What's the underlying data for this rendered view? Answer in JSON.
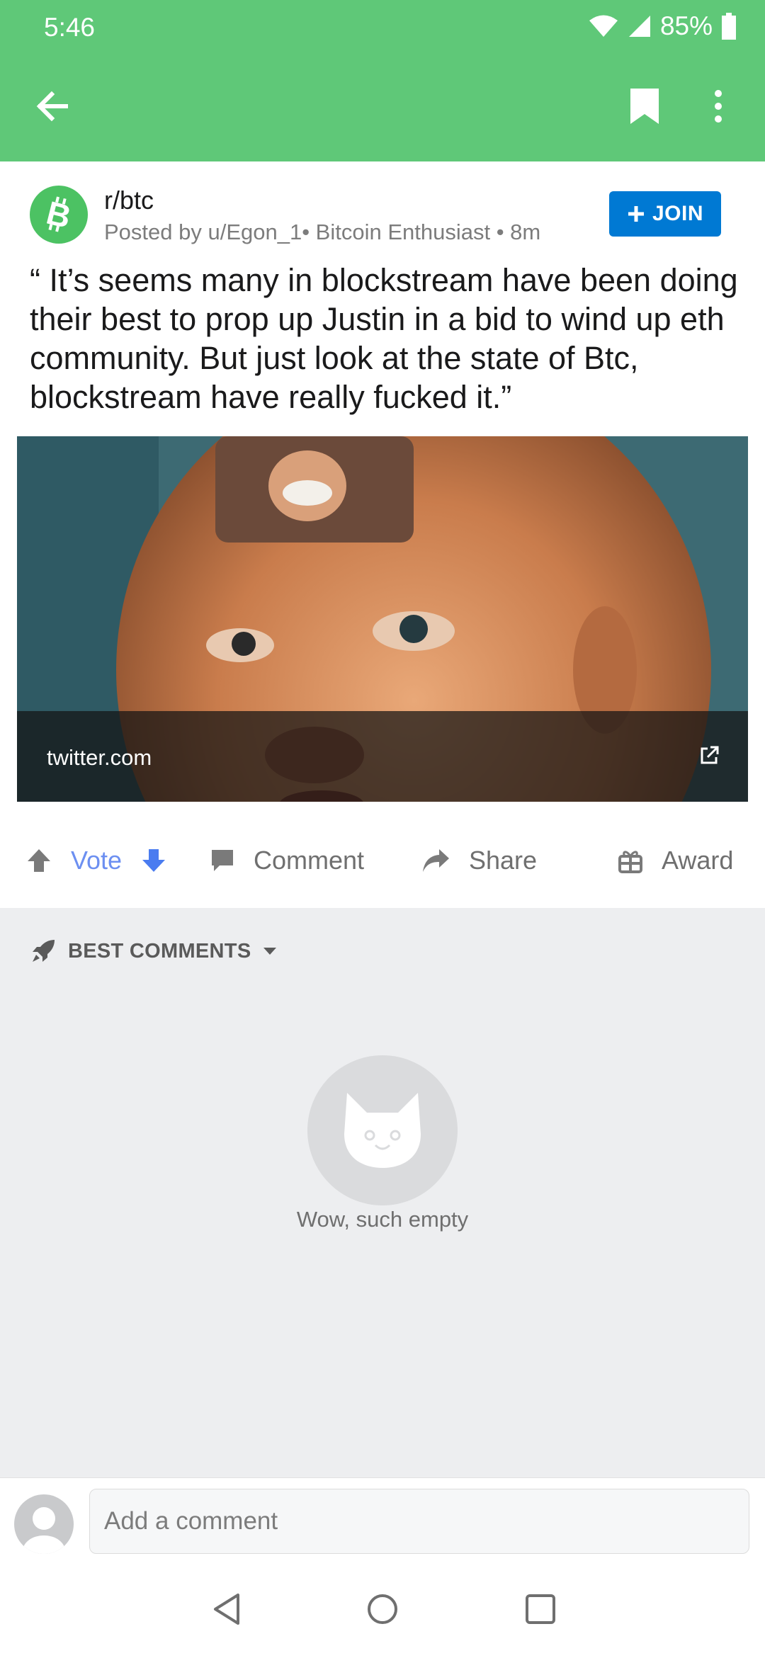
{
  "status_bar": {
    "time": "5:46",
    "battery": "85%"
  },
  "post": {
    "subreddit": "r/btc",
    "posted_by": "Posted by u/Egon_1• Bitcoin Enthusiast • 8m",
    "join_label": "JOIN",
    "title": "“ It’s seems many in blockstream have been doing their best to prop up Justin in a bid to wind up eth community. But just look at the state of Btc, blockstream have really fucked it.”",
    "link_domain": "twitter.com"
  },
  "actions": {
    "vote": "Vote",
    "comment": "Comment",
    "share": "Share",
    "award": "Award"
  },
  "comments": {
    "sort_label": "BEST COMMENTS",
    "empty_text": "Wow, such empty"
  },
  "composer": {
    "placeholder": "Add a comment"
  },
  "colors": {
    "header": "#5fc878",
    "join": "#0079d3",
    "vote_accent": "#6c8ff1"
  }
}
